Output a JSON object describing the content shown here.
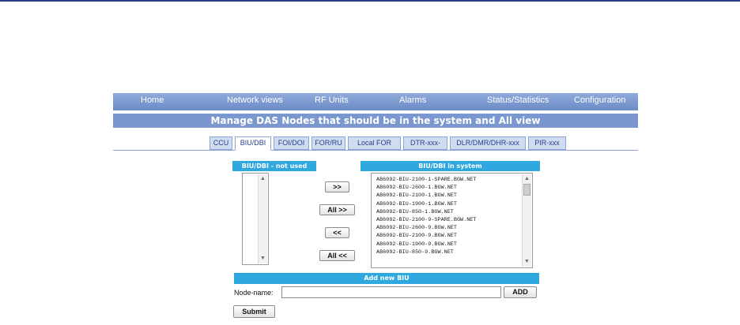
{
  "nav": {
    "items": [
      "Home",
      "Network views",
      "RF Units",
      "Alarms",
      "Status/Statistics",
      "Configuration"
    ]
  },
  "page_title": "Manage DAS Nodes that should be in the system and All view",
  "tabs": [
    "CCU",
    "BIU/DBI",
    "FOI/DOI",
    "FOR/RU",
    "Local FOR",
    "DTR-xxx-",
    "DLR/DMR/DHR-xxx",
    "PIR-xxx"
  ],
  "active_tab": "BIU/DBI",
  "not_used": {
    "header": "BIU/DBI - not used"
  },
  "in_system": {
    "header": "BIU/DBI in system",
    "items": [
      "AB6092-BIU-2100-1-SPARE.BGW.NET",
      "AB6092-BIU-2600-1.BGW.NET",
      "AB6092-BIU-2100-1.BGW.NET",
      "AB6092-BIU-1900-1.BGW.NET",
      "AB6092-BIU-850-1.BGW.NET",
      "AB6092-BIU-2100-9-SPARE.BGW.NET",
      "AB6092-BIU-2600-9.BGW.NET",
      "AB6092-BIU-2100-9.BGW.NET",
      "AB6092-BIU-1900-9.BGW.NET",
      "AB6092-BIU-850-9.BGW.NET"
    ]
  },
  "transfer_buttons": {
    "move_right": ">>",
    "move_all_right": "All >>",
    "move_left": "<<",
    "move_all_left": "All <<"
  },
  "add_new": {
    "header": "Add new BIU",
    "label": "Node-name:",
    "value": "",
    "add_button": "ADD"
  },
  "submit_button": "Submit",
  "colors": {
    "nav_bar": "#7896cd",
    "title_bar": "#7a98cf",
    "section_header": "#2ea8de",
    "tab": "#cfdcf1",
    "top_rule": "#2a3f8a"
  }
}
